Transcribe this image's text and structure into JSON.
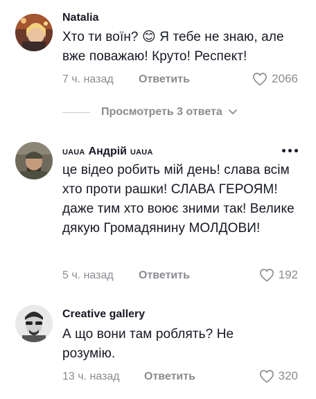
{
  "comments": [
    {
      "username": "Natalia",
      "text": "Хто ти воїн? 😊 Я тебе не знаю, але вже поважаю! Круто! Респект!",
      "time": "7 ч. назад",
      "reply_label": "Ответить",
      "likes": "2066"
    },
    {
      "flag_before": "UAUA",
      "username": "Андрій",
      "flag_after": "UAUA",
      "text": "це відео робить мій день! слава всім хто проти рашки! СЛАВА ГЕРОЯМ! даже тим хто воює зними так! Велике дякую Громадянину МОЛДОВИ!",
      "time": "5 ч. назад",
      "reply_label": "Ответить",
      "likes": "192"
    },
    {
      "username": "Creative gallery",
      "text": "А що вони там роблять? Не розумію.",
      "time": "13 ч. назад",
      "reply_label": "Ответить",
      "likes": "320"
    }
  ],
  "view_replies_label": "Просмотреть 3 ответа",
  "colors": {
    "text": "#161823",
    "muted": "#8a8b91",
    "divider": "#c9cacd"
  },
  "icons": [
    "heart-icon",
    "chevron-down-icon",
    "more-options-icon"
  ]
}
